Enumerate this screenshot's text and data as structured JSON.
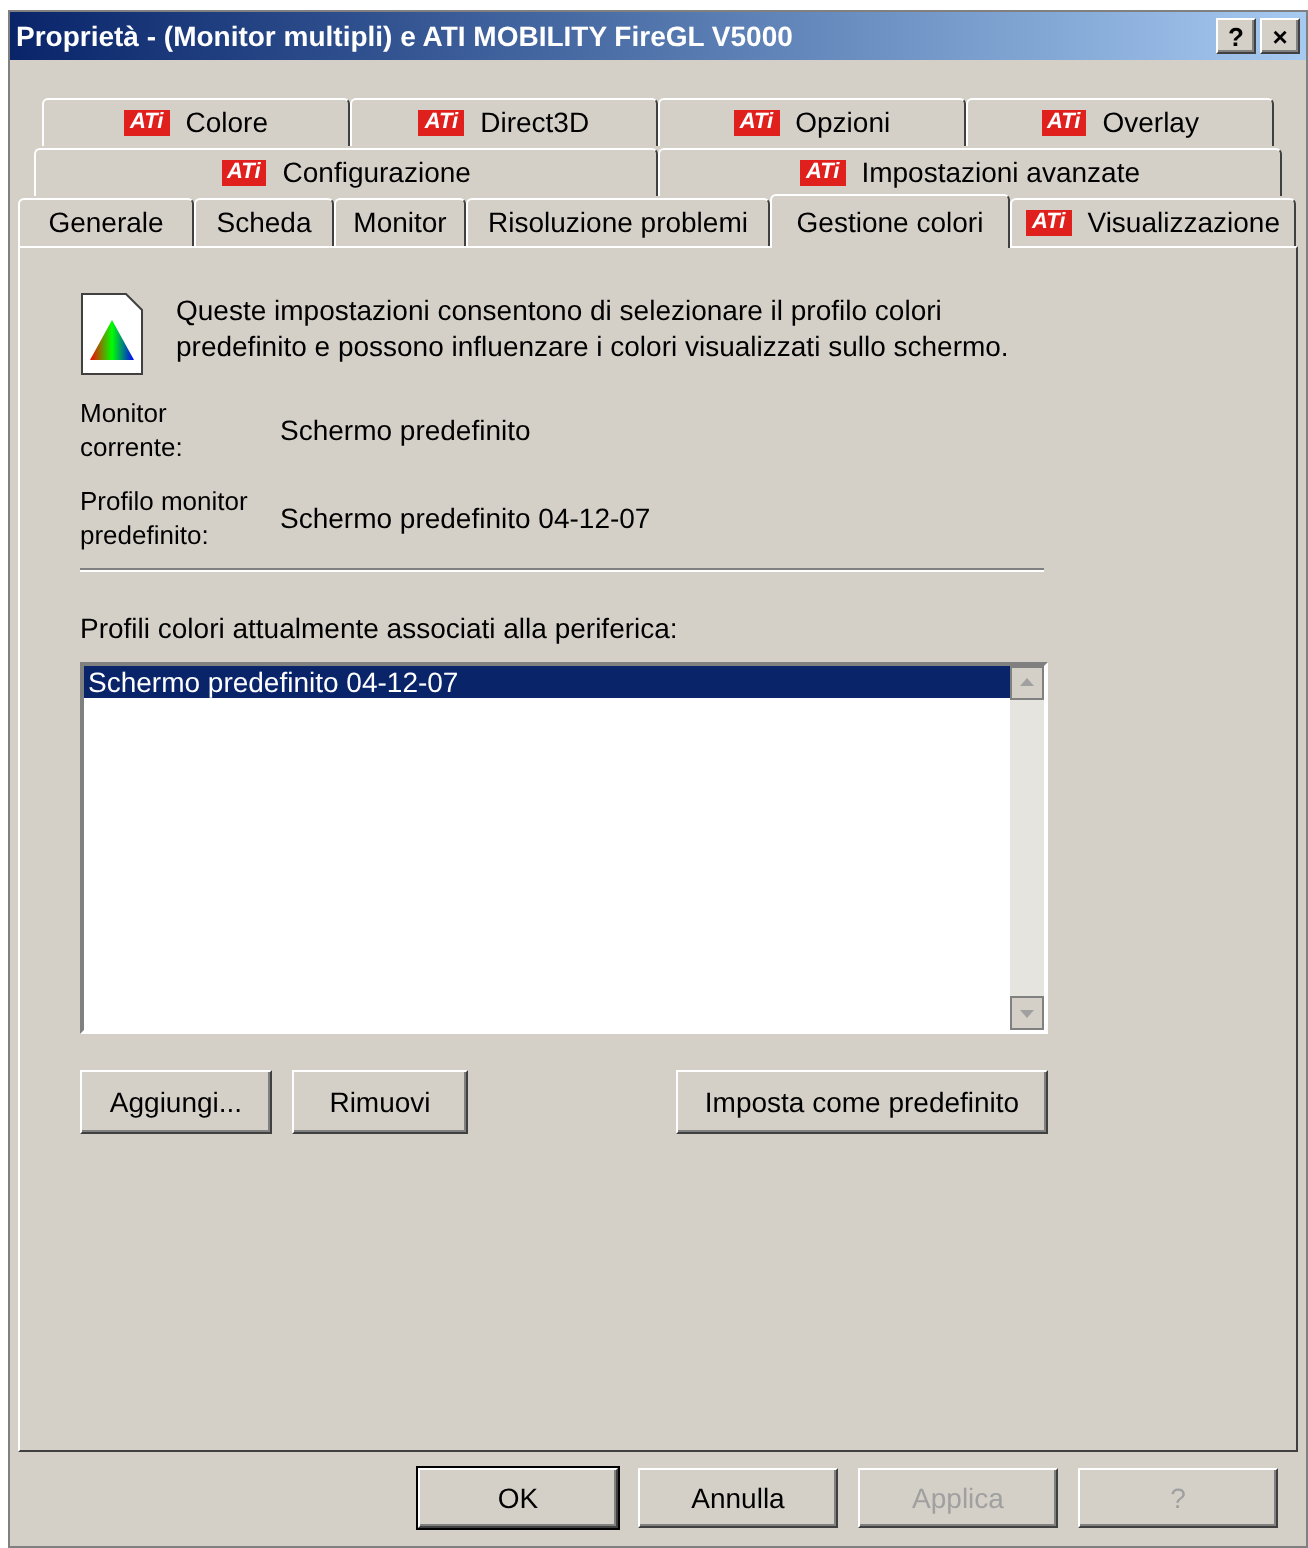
{
  "window": {
    "title": "Proprietà - (Monitor multipli) e ATI MOBILITY FireGL V5000",
    "controls": [
      "?",
      "×"
    ]
  },
  "tab_rows": [
    [
      {
        "label": "Colore",
        "badge": "ATi",
        "selected": false
      },
      {
        "label": "Direct3D",
        "badge": "ATi",
        "selected": false
      },
      {
        "label": "Opzioni",
        "badge": "ATi",
        "selected": false
      },
      {
        "label": "Overlay",
        "badge": "ATi",
        "selected": false
      }
    ],
    [
      {
        "label": "Configurazione",
        "badge": "ATi",
        "selected": false
      },
      {
        "label": "Impostazioni avanzate",
        "badge": "ATi",
        "selected": false
      }
    ],
    [
      {
        "label": "Generale",
        "selected": false
      },
      {
        "label": "Scheda",
        "selected": false
      },
      {
        "label": "Monitor",
        "selected": false
      },
      {
        "label": "Risoluzione problemi",
        "selected": false
      },
      {
        "label": "Gestione colori",
        "selected": true
      },
      {
        "label": "Visualizzazione",
        "badge": "ATi",
        "selected": false
      }
    ]
  ],
  "intro": "Queste impostazioni consentono di selezionare il profilo colori predefinito e possono influenzare i colori visualizzati sullo schermo.",
  "info": [
    {
      "label": "Monitor corrente:",
      "value": "Schermo predefinito"
    },
    {
      "label": "Profilo monitor predefinito:",
      "value": "Schermo predefinito 04-12-07"
    }
  ],
  "profiles": {
    "label": "Profili colori attualmente associati alla periferica:",
    "items": [
      {
        "text": "Schermo predefinito 04-12-07",
        "selected": true
      }
    ]
  },
  "profile_buttons": [
    {
      "label": "Aggiungi...",
      "disabled": false
    },
    {
      "label": "Rimuovi",
      "disabled": false
    },
    {
      "label": "Imposta come predefinito",
      "disabled": false
    }
  ],
  "dialog_buttons": [
    {
      "label": "OK",
      "disabled": false,
      "default": true
    },
    {
      "label": "Annulla",
      "disabled": false,
      "default": false
    },
    {
      "label": "Applica",
      "disabled": true,
      "default": false
    },
    {
      "label": "?",
      "disabled": true,
      "default": false
    }
  ]
}
